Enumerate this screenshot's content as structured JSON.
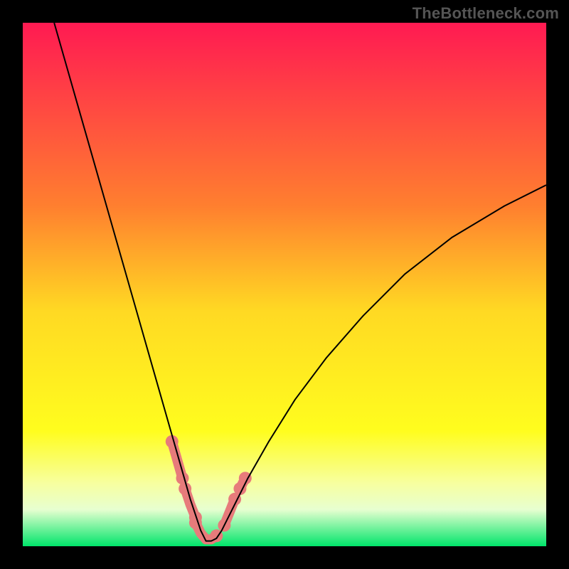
{
  "watermark": "TheBottleneck.com",
  "chart_data": {
    "type": "line",
    "title": "",
    "xlabel": "",
    "ylabel": "",
    "xlim": [
      0,
      100
    ],
    "ylim": [
      0,
      100
    ],
    "grid": false,
    "background_gradient": [
      {
        "stop": 0.0,
        "color": "#ff1a52"
      },
      {
        "stop": 0.35,
        "color": "#ff7f2f"
      },
      {
        "stop": 0.55,
        "color": "#ffd923"
      },
      {
        "stop": 0.78,
        "color": "#fffd1e"
      },
      {
        "stop": 0.88,
        "color": "#f7ffa0"
      },
      {
        "stop": 0.93,
        "color": "#e7ffd0"
      },
      {
        "stop": 1.0,
        "color": "#00e56a"
      }
    ],
    "series": [
      {
        "name": "bottleneck-curve",
        "color": "#000000",
        "x": [
          6.0,
          8.0,
          10.0,
          12.0,
          14.0,
          16.0,
          18.0,
          20.0,
          22.0,
          24.0,
          26.0,
          28.0,
          30.0,
          32.0,
          33.0,
          34.0,
          35.0,
          36.0,
          37.0,
          38.0,
          40.0,
          43.0,
          47.0,
          52.0,
          58.0,
          65.0,
          73.0,
          82.0,
          92.0,
          100.0
        ],
        "y": [
          100.0,
          93.0,
          86.0,
          79.0,
          72.0,
          65.0,
          58.0,
          51.0,
          44.0,
          37.0,
          30.0,
          23.0,
          16.0,
          9.0,
          6.0,
          3.0,
          1.0,
          1.0,
          1.5,
          3.0,
          7.0,
          13.0,
          20.0,
          28.0,
          36.0,
          44.0,
          52.0,
          59.0,
          65.0,
          69.0
        ]
      }
    ],
    "markers": {
      "name": "highlight-segments",
      "color": "#e77b7b",
      "segments": [
        {
          "x": [
            28.5,
            29.5,
            30.5
          ],
          "y": [
            20.0,
            16.5,
            13.0
          ]
        },
        {
          "x": [
            31.0,
            32.0,
            33.0
          ],
          "y": [
            11.0,
            8.0,
            5.5
          ]
        },
        {
          "x": [
            33.0,
            34.0,
            35.0,
            36.0,
            37.0
          ],
          "y": [
            4.5,
            2.5,
            1.3,
            1.3,
            2.0
          ]
        },
        {
          "x": [
            38.5,
            39.5,
            40.5
          ],
          "y": [
            4.0,
            6.5,
            9.0
          ]
        },
        {
          "x": [
            41.5,
            42.5
          ],
          "y": [
            11.0,
            13.0
          ]
        }
      ]
    }
  }
}
